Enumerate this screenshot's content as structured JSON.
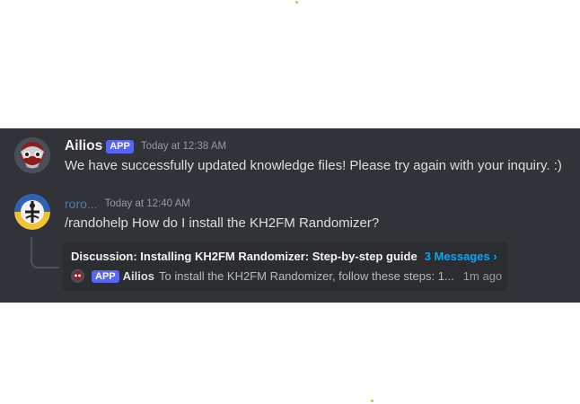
{
  "messages": [
    {
      "author": "Ailios",
      "badge": "APP",
      "timestamp": "Today at 12:38 AM",
      "text": "We have successfully updated knowledge files! Please try again with your inquiry. :)",
      "avatar_icon": "bot-avatar-icon"
    },
    {
      "author": "roro...",
      "timestamp": "Today at 12:40 AM",
      "text": "/randohelp How do I install the KH2FM Randomizer?",
      "avatar_icon": "user-avatar-icon"
    }
  ],
  "thread": {
    "title": "Discussion: Installing KH2FM Randomizer: Step-by-step guide",
    "message_count": "3 Messages ›",
    "preview": {
      "badge": "APP",
      "author": "Ailios",
      "text": "To install the KH2FM Randomizer, follow these steps: 1...",
      "time": "1m ago"
    }
  },
  "colors": {
    "chat_background": "#313338",
    "thread_card_background": "#2b2d31",
    "app_badge": "#5865f2",
    "link_blue": "#00a8fc",
    "username_blue": "#4f79b8",
    "accent_dot": "#f0b232"
  }
}
